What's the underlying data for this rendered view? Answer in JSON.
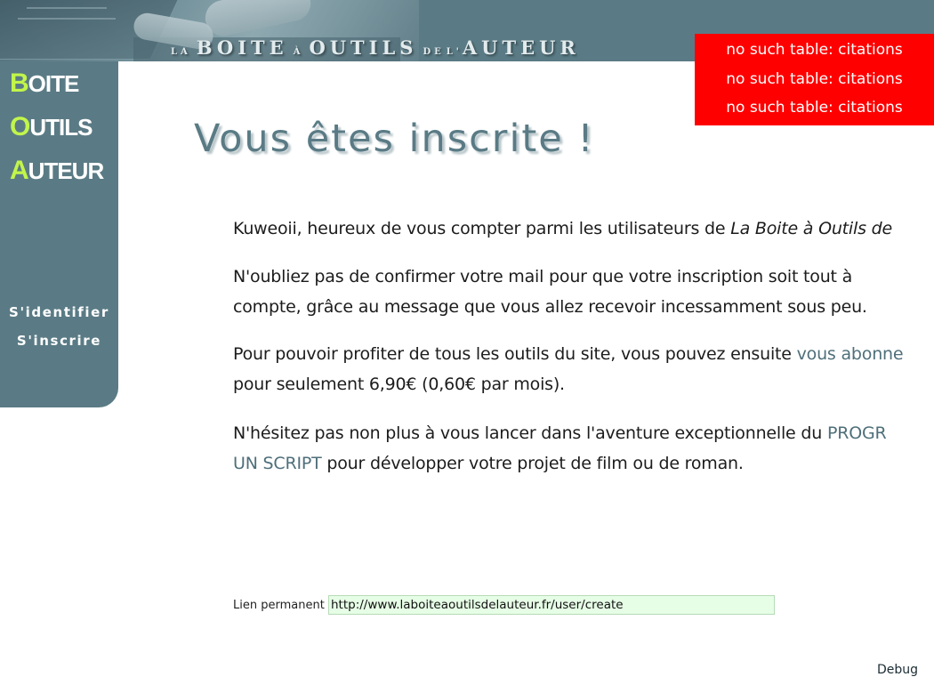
{
  "header": {
    "banner": {
      "w1": "LA",
      "w2": "BOITE",
      "w3": "À",
      "w4": "OUTILS",
      "w5": "DE",
      "w6": "L'",
      "w7": "AUTEUR"
    }
  },
  "sidebar": {
    "brand": [
      {
        "initial": "B",
        "rest": "OITE"
      },
      {
        "initial": "O",
        "rest": "UTILS"
      },
      {
        "initial": "A",
        "rest": "UTEUR"
      }
    ],
    "nav": {
      "login": "S'identifier",
      "register": "S'inscrire"
    }
  },
  "errors": [
    "no such table: citations",
    "no such table: citations",
    "no such table: citations"
  ],
  "main": {
    "title": "Vous êtes inscrite !",
    "p1": {
      "text": "Kuweoii, heureux de vous compter parmi les utilisateurs de ",
      "site": "La Boite à Outils de"
    },
    "p2": {
      "line1": "N'oubliez pas de confirmer votre mail pour que votre inscription soit tout à",
      "line2": "compte, grâce au message que vous allez recevoir incessamment sous peu."
    },
    "p3": {
      "line1": "Pour pouvoir profiter de tous les outils du site, vous pouvez ensuite ",
      "link": "vous abonne",
      "line2": "pour seulement 6,90€ (0,60€ par mois)."
    },
    "p4": {
      "line1": "N'hésitez pas non plus à vous lancer dans l'aventure exceptionnelle du ",
      "link1": "PROGR",
      "link2": "UN SCRIPT",
      "line2": " pour développer votre projet de film ou de roman."
    }
  },
  "permalink": {
    "label": "Lien permanent",
    "value": "http://www.laboiteaoutilsdelauteur.fr/user/create"
  },
  "footer": {
    "debug": "Debug"
  },
  "colors": {
    "brand": "#5a7b85",
    "brand_initial": "#c2f54b",
    "error_bg": "#ff0000",
    "permalink_bg": "#e6fde6"
  }
}
